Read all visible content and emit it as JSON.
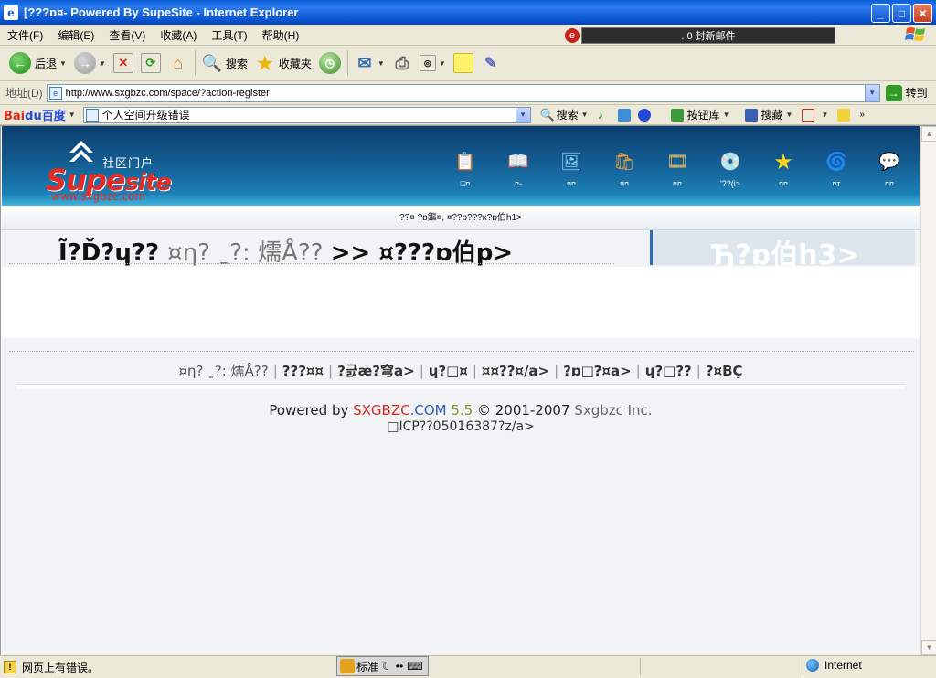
{
  "window": {
    "title": "[???ɒ¤- Powered By SupeSite - Internet Explorer",
    "minimize": "_",
    "maximize": "□",
    "close": "✕"
  },
  "menu": {
    "items": [
      "文件(F)",
      "编辑(E)",
      "查看(V)",
      "收藏(A)",
      "工具(T)",
      "帮助(H)"
    ],
    "mail_status": ". 0 封新邮件"
  },
  "toolbar": {
    "back": "后退",
    "search": "搜索",
    "favorites": "收藏夹"
  },
  "address": {
    "label": "地址(D)",
    "url": "http://www.sxgbzc.com/space/?action-register",
    "go": "转到"
  },
  "baidu": {
    "logo_bai": "Bai",
    "logo_du": "du百度",
    "query": "个人空间升级错误",
    "search": "搜索",
    "button_lib": "按钮库",
    "collect": "搜藏"
  },
  "site": {
    "logo_cn": "社区门户",
    "logo_supe": "Supe",
    "logo_site": "site",
    "logo_url": "www.sxgbzc.com",
    "nav": [
      {
        "icon": "bookmark-icon",
        "glyph": "📋",
        "label": "□¤"
      },
      {
        "icon": "book-icon",
        "glyph": "📖",
        "label": "¤-"
      },
      {
        "icon": "photo-icon",
        "glyph": "🖼",
        "label": "¤¤"
      },
      {
        "icon": "bag-icon",
        "glyph": "🛍",
        "label": "¤¤"
      },
      {
        "icon": "film-icon",
        "glyph": "🎞",
        "label": "¤¤"
      },
      {
        "icon": "music-icon",
        "glyph": "💿",
        "label": "'??(i>"
      },
      {
        "icon": "star-icon",
        "glyph": "★",
        "label": "¤¤"
      },
      {
        "icon": "swirl-icon",
        "glyph": "🌀",
        "label": "¤т"
      },
      {
        "icon": "chat-icon",
        "glyph": "💬",
        "label": "¤¤"
      }
    ],
    "notice": "??¤ ?ɒ鏂¤, ¤??ɒ???ĸ?ɒ伯h1>",
    "breadcrumb": {
      "part1": "Ĩ?Ď?ɥ?? ",
      "part2": "¤η?  ˍ?:  燸Å?? ",
      "part3": ">> ¤???ɒ伯p>"
    },
    "side_title": "Ђ?ɒ伯h3>",
    "footer_links": [
      {
        "text": "¤η?  ˍ?:  燸Å??",
        "style": "grey"
      },
      {
        "text": "???¤¤",
        "style": "bold"
      },
      {
        "text": "?긄æ?穹a>",
        "style": "bold"
      },
      {
        "text": "ɥ?□¤",
        "style": "bold"
      },
      {
        "text": "¤¤??¤/a>",
        "style": "bold"
      },
      {
        "text": "?ɒ□?¤a>",
        "style": "bold"
      },
      {
        "text": "ɥ?□??",
        "style": "bold"
      },
      {
        "text": "?¤BÇ",
        "style": "bold"
      }
    ],
    "powered_prefix": "Powered by ",
    "powered_brand_a": "SXGBZC",
    "powered_brand_b": ".COM",
    "powered_version": " 5.5",
    "powered_copy": " © 2001-2007 ",
    "powered_inc": "Sxgbzc Inc.",
    "icp": "□ICP??05016387?z/a>"
  },
  "status": {
    "message": "网页上有错误。",
    "ime_mode": "标准",
    "zone": "Internet"
  },
  "colors": {
    "titlebar": "#0a55d0",
    "site_header": "#135c92",
    "brand_red": "#d22a22"
  }
}
